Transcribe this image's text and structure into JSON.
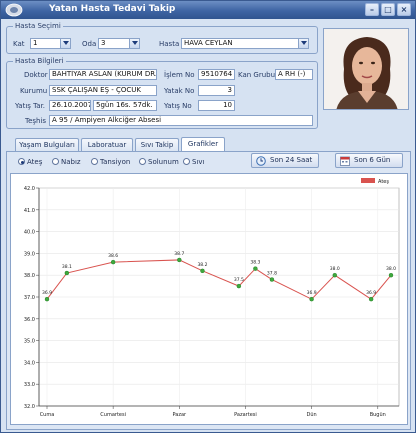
{
  "window": {
    "title": "Yatan Hasta Tedavi Takip"
  },
  "hasta_secimi": {
    "legend": "Hasta Seçimi",
    "kat_label": "Kat",
    "kat_value": "1",
    "oda_label": "Oda",
    "oda_value": "3",
    "hasta_label": "Hasta",
    "hasta_value": "HAVA CEYLAN"
  },
  "hasta_bilgileri": {
    "legend": "Hasta Bilgileri",
    "doktor_label": "Doktor",
    "doktor_value": "BAHTİYAR ASLAN (KURUM DR.)",
    "islem_label": "İşlem No",
    "islem_value": "9510764",
    "kan_label": "Kan Grubu",
    "kan_value": "A RH (-)",
    "kurum_label": "Kurumu",
    "kurum_value": "SSK ÇALIŞAN EŞ - ÇOCUK",
    "yatak_label": "Yatak No",
    "yatak_value": "3",
    "yatis_label": "Yatış Tar.",
    "yatis_date": "26.10.2007",
    "yatis_duration": "5gün 16s. 57dk.",
    "yatis_no_label": "Yatış No",
    "yatis_no_value": "10",
    "teshis_label": "Teşhis",
    "teshis_value": "A 95 / Ampiyen Alkciğer Absesi"
  },
  "tabs": [
    {
      "label": "Yaşam Bulguları"
    },
    {
      "label": "Laboratuar"
    },
    {
      "label": "Sıvı Takip"
    },
    {
      "label": "Grafikler"
    }
  ],
  "radios": [
    {
      "label": "Ateş",
      "checked": true
    },
    {
      "label": "Nabız",
      "checked": false
    },
    {
      "label": "Tansiyon",
      "checked": false
    },
    {
      "label": "Solunum",
      "checked": false
    },
    {
      "label": "Sıvı",
      "checked": false
    }
  ],
  "buttons": {
    "son24": "Son 24 Saat",
    "son6": "Son 6 Gün"
  },
  "colors": {
    "series": "#d9534f",
    "point": "#3ea83e",
    "titlebar": "#3e64a3"
  },
  "chart_data": {
    "type": "line",
    "legend": "Ateş",
    "legend_position": "top-right",
    "grid": true,
    "ylim": [
      32.0,
      42.0
    ],
    "yticks": [
      "42.0",
      "41.0",
      "40.0",
      "39.0",
      "38.0",
      "37.0",
      "36.0",
      "35.0",
      "34.0",
      "33.0",
      "32.0"
    ],
    "categories": [
      "Cuma",
      "Cumartesi",
      "Pazar",
      "Pazartesi",
      "Dün",
      "Bugün"
    ],
    "series": [
      {
        "name": "Ateş",
        "points": [
          {
            "x": 0.0,
            "y": 36.9,
            "label": "36.9"
          },
          {
            "x": 0.3,
            "y": 38.1,
            "label": "38.1"
          },
          {
            "x": 1.0,
            "y": 38.6,
            "label": "38.6"
          },
          {
            "x": 2.0,
            "y": 38.7,
            "label": "38.7"
          },
          {
            "x": 2.35,
            "y": 38.2,
            "label": "38.2"
          },
          {
            "x": 2.9,
            "y": 37.5,
            "label": "37.5"
          },
          {
            "x": 3.15,
            "y": 38.3,
            "label": "38.3"
          },
          {
            "x": 3.4,
            "y": 37.8,
            "label": "37.8"
          },
          {
            "x": 4.0,
            "y": 36.9,
            "label": "36.9"
          },
          {
            "x": 4.35,
            "y": 38.0,
            "label": "38.0"
          },
          {
            "x": 4.9,
            "y": 36.9,
            "label": "36.9"
          },
          {
            "x": 5.2,
            "y": 38.0,
            "label": "38.0"
          }
        ]
      }
    ]
  }
}
